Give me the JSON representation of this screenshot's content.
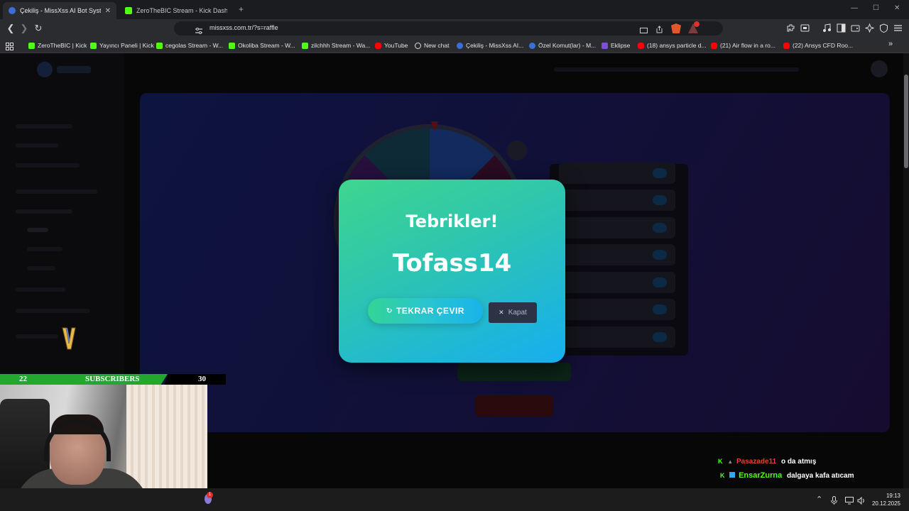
{
  "tabs": [
    {
      "title": "Çekiliş - MissXss AI Bot System",
      "active": true,
      "close": "✕"
    },
    {
      "title": "ZeroTheBIC Stream - Kick Dashboard",
      "active": false
    }
  ],
  "new_tab": "+",
  "window_controls": {
    "minimize": "—",
    "maximize": "☐",
    "close": "✕"
  },
  "toolbar": {
    "url": "missxss.com.tr/?s=raffle",
    "back": "❮",
    "forward": "❯",
    "reload": "↻"
  },
  "bookmarks": [
    {
      "label": "ZeroTheBIC | Kick",
      "icon": "kick"
    },
    {
      "label": "Yayıncı Paneli | Kick",
      "icon": "kick"
    },
    {
      "label": "cegolas Stream - W...",
      "icon": "kick"
    },
    {
      "label": "Okoliba Stream - W...",
      "icon": "kick"
    },
    {
      "label": "zilchhh Stream - Wa...",
      "icon": "kick"
    },
    {
      "label": "YouTube",
      "icon": "youtube"
    },
    {
      "label": "New chat",
      "icon": "chat"
    },
    {
      "label": "Çekiliş - MissXss AI...",
      "icon": "missxss"
    },
    {
      "label": "Özel Komut(lar) - M...",
      "icon": "missxss"
    },
    {
      "label": "Eklipse",
      "icon": "eklipse"
    },
    {
      "label": "(18) ansys particle d...",
      "icon": "youtube"
    },
    {
      "label": "(21) Air flow in a ro...",
      "icon": "youtube"
    },
    {
      "label": "(22) Ansys CFD Roo...",
      "icon": "youtube"
    }
  ],
  "bookmarks_more": "»",
  "modal": {
    "title": "Tebrikler!",
    "winner": "Tofass14",
    "respin_label": "TEKRAR ÇEVIR",
    "close_label": "Kapat"
  },
  "overlay": {
    "sub_left": "22",
    "sub_label": "SUBSCRIBERS",
    "sub_right": "30"
  },
  "chat": [
    {
      "user": "Pasazade11",
      "user_color": "#e0413a",
      "message": "o da atmış"
    },
    {
      "user": "EnsarZurna",
      "user_color": "#53fc18",
      "message": "dalgaya kafa atıcam"
    }
  ],
  "taskbar": {
    "time": "19:13",
    "date": "20.12.2025",
    "notification_count": "1"
  },
  "colors": {
    "modal_gradient_start": "#3fd58e",
    "modal_gradient_end": "#16aef0",
    "kick_green": "#53fc18",
    "close_button": "#2d3345"
  }
}
